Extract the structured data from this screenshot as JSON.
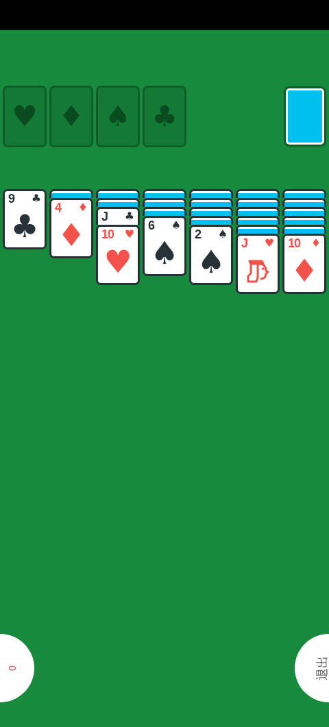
{
  "foundations": [
    {
      "suit": "♥"
    },
    {
      "suit": "♦"
    },
    {
      "suit": "♠"
    },
    {
      "suit": "♣"
    }
  ],
  "stock": {
    "empty": false
  },
  "tableau": [
    {
      "cards": [
        {
          "kind": "pip",
          "rank": "9",
          "suit": "♣",
          "pip": "♣",
          "color": "#263238"
        }
      ]
    },
    {
      "cards": [
        {
          "kind": "back"
        },
        {
          "kind": "pip",
          "rank": "4",
          "suit": "♦",
          "pip": "♦",
          "color": "#f2524a"
        }
      ]
    },
    {
      "cards": [
        {
          "kind": "back"
        },
        {
          "kind": "back"
        },
        {
          "kind": "figure",
          "rank": "J",
          "suit": "♣",
          "color": "#263238"
        },
        {
          "kind": "pip",
          "rank": "10",
          "suit": "♥",
          "pip": "♥",
          "color": "#f2524a"
        }
      ]
    },
    {
      "cards": [
        {
          "kind": "back"
        },
        {
          "kind": "back"
        },
        {
          "kind": "back"
        },
        {
          "kind": "pip",
          "rank": "6",
          "suit": "♠",
          "pip": "♠",
          "color": "#263238"
        }
      ]
    },
    {
      "cards": [
        {
          "kind": "back"
        },
        {
          "kind": "back"
        },
        {
          "kind": "back"
        },
        {
          "kind": "back"
        },
        {
          "kind": "pip",
          "rank": "2",
          "suit": "♠",
          "pip": "♠",
          "color": "#263238"
        }
      ]
    },
    {
      "cards": [
        {
          "kind": "back"
        },
        {
          "kind": "back"
        },
        {
          "kind": "back"
        },
        {
          "kind": "back"
        },
        {
          "kind": "back"
        },
        {
          "kind": "figure",
          "rank": "J",
          "suit": "♥",
          "color": "#f2524a"
        }
      ]
    },
    {
      "cards": [
        {
          "kind": "back"
        },
        {
          "kind": "back"
        },
        {
          "kind": "back"
        },
        {
          "kind": "back"
        },
        {
          "kind": "back"
        },
        {
          "kind": "pip",
          "rank": "10",
          "suit": "♦",
          "pip": "♦",
          "color": "#f2524a"
        }
      ]
    }
  ],
  "left_button": {
    "label": "0"
  },
  "right_button": {
    "label": "退出"
  }
}
